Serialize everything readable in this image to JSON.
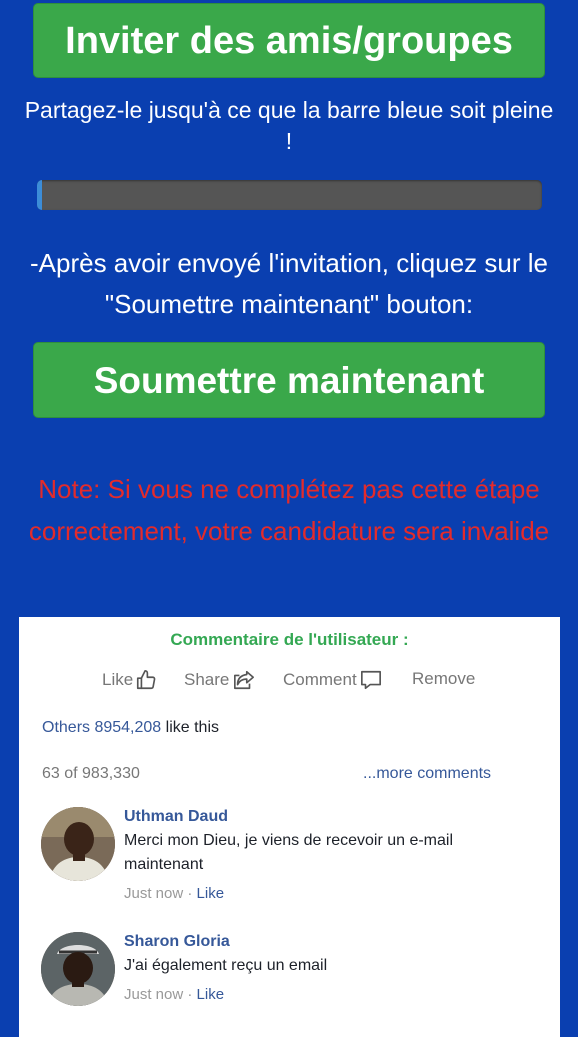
{
  "header": {
    "invite_label": "Inviter des amis/groupes",
    "share_instruction": "Partagez-le jusqu'à ce que la barre bleue soit pleine !",
    "progress_fraction": 0.01,
    "after_instruction": "-Après avoir envoyé l'invitation, cliquez sur le \"Soumettre maintenant\" bouton:",
    "submit_label": "Soumettre maintenant",
    "note": "Note: Si vous ne complétez pas cette étape correctement, votre candidature sera invalide"
  },
  "comments_panel": {
    "title": "Commentaire de l'utilisateur :",
    "actions": {
      "like": "Like",
      "share": "Share",
      "comment": "Comment",
      "remove": "Remove"
    },
    "likes_prefix": "Others 8954,208",
    "likes_suffix": " like this",
    "count": "63 of 983,330",
    "more": "...more comments",
    "comments": [
      {
        "name": "Uthman Daud",
        "text": "Merci mon Dieu, je viens de recevoir un e-mail maintenant",
        "time": "Just now",
        "sep": " · ",
        "like": "Like"
      },
      {
        "name": "Sharon Gloria",
        "text": "J'ai également reçu un email",
        "time": "Just now",
        "sep": " · ",
        "like": "Like"
      }
    ]
  },
  "colors": {
    "background": "#0a3fb0",
    "button_green": "#3aa84a",
    "note_red": "#e32b2b",
    "link_blue": "#365899",
    "title_green": "#34a853"
  }
}
